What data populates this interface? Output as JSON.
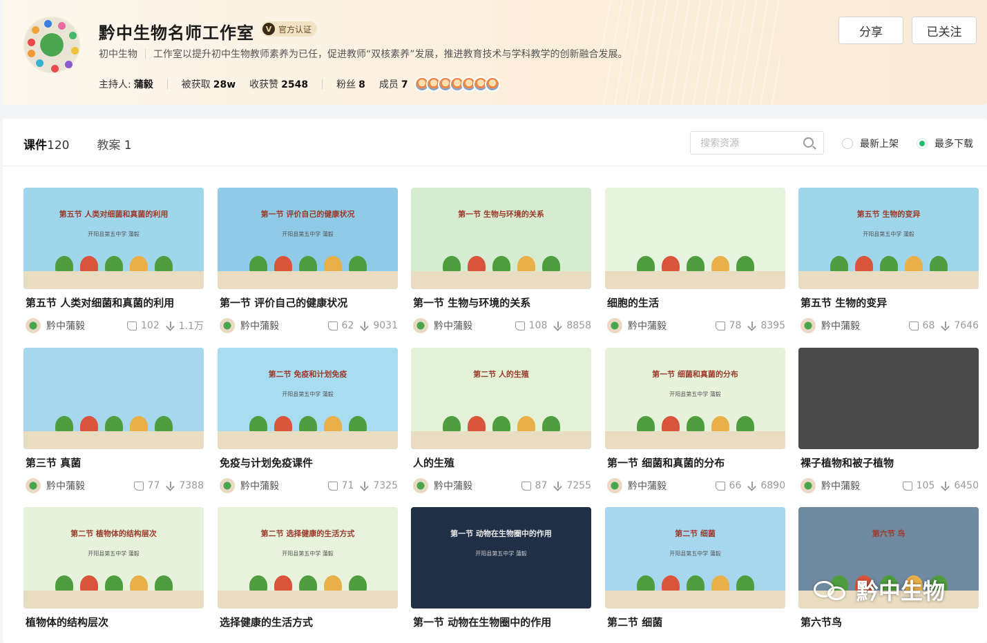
{
  "header": {
    "title": "黔中生物名师工作室",
    "badge_label": "官方认证",
    "badge_icon": "V",
    "subject": "初中生物",
    "description": "工作室以提升初中生物教师素养为已任，促进教师“双核素养”发展，推进教育技术与学科教学的创新融合发展。",
    "host_label": "主持人:",
    "host_name": "蒲毅",
    "stats": [
      {
        "label": "被获取",
        "value": "28w"
      },
      {
        "label": "收获赞",
        "value": "2548"
      },
      {
        "label": "粉丝",
        "value": "8"
      },
      {
        "label": "成员",
        "value": "7"
      }
    ],
    "share_label": "分享",
    "follow_label": "已关注"
  },
  "tabs": [
    {
      "label": "课件",
      "count": "120",
      "active": true
    },
    {
      "label": "教案",
      "count": "1",
      "active": false
    }
  ],
  "search": {
    "placeholder": "搜索资源"
  },
  "sort": {
    "newest": "最新上架",
    "most_downloaded": "最多下载",
    "selected": "most_downloaded"
  },
  "cards": [
    {
      "title": "第五节 人类对细菌和真菌的利用",
      "author": "黔中蒲毅",
      "likes": "102",
      "downloads": "1.1万",
      "thumb_title": "第五节 人类对细菌和真菌的利用",
      "thumb_sub": "开阳县第五中学 蒲毅",
      "bg": "#9fd6ec"
    },
    {
      "title": "第一节 评价自己的健康状况",
      "author": "黔中蒲毅",
      "likes": "62",
      "downloads": "9031",
      "thumb_title": "第一节 评价自己的健康状况",
      "thumb_sub": "开阳县第五中学 蒲毅",
      "bg": "#8fcbe6"
    },
    {
      "title": "第一节 生物与环境的关系",
      "author": "黔中蒲毅",
      "likes": "108",
      "downloads": "8858",
      "thumb_title": "第一节 生物与环境的关系",
      "thumb_sub": "",
      "bg": "#d6ecd0"
    },
    {
      "title": "细胞的生活",
      "author": "黔中蒲毅",
      "likes": "78",
      "downloads": "8395",
      "thumb_title": "",
      "thumb_sub": "",
      "bg": "#e6f3df"
    },
    {
      "title": "第五节 生物的变异",
      "author": "黔中蒲毅",
      "likes": "68",
      "downloads": "7646",
      "thumb_title": "第五节 生物的变异",
      "thumb_sub": "开阳县第五中学 蒲毅",
      "bg": "#9fd6ec"
    },
    {
      "title": "第三节 真菌",
      "author": "黔中蒲毅",
      "likes": "77",
      "downloads": "7388",
      "thumb_title": "",
      "thumb_sub": "",
      "bg": "#a6d7ee"
    },
    {
      "title": "免疫与计划免疫课件",
      "author": "黔中蒲毅",
      "likes": "71",
      "downloads": "7325",
      "thumb_title": "第二节 免疫和计划免疫",
      "thumb_sub": "开阳县第五中学 蒲毅",
      "bg": "#a8dcf0"
    },
    {
      "title": "人的生殖",
      "author": "黔中蒲毅",
      "likes": "87",
      "downloads": "7255",
      "thumb_title": "第二节 人的生殖",
      "thumb_sub": "",
      "bg": "#e3f1d7"
    },
    {
      "title": "第一节 细菌和真菌的分布",
      "author": "黔中蒲毅",
      "likes": "66",
      "downloads": "6890",
      "thumb_title": "第一节 细菌和真菌的分布",
      "thumb_sub": "开阳县第五中学 蒲毅",
      "bg": "#e7f2db"
    },
    {
      "title": "裸子植物和被子植物",
      "author": "黔中蒲毅",
      "likes": "105",
      "downloads": "6450",
      "thumb_title": "",
      "thumb_sub": "",
      "bg": "#4a4a4a"
    },
    {
      "title": "植物体的结构层次",
      "author": "",
      "likes": "",
      "downloads": "",
      "thumb_title": "第二节 植物体的结构层次",
      "thumb_sub": "开阳县第五中学 蒲毅",
      "bg": "#e6f2dc"
    },
    {
      "title": "选择健康的生活方式",
      "author": "",
      "likes": "",
      "downloads": "",
      "thumb_title": "第二节 选择健康的生活方式",
      "thumb_sub": "开阳县第五中学 蒲毅",
      "bg": "#e7f3dd"
    },
    {
      "title": "第一节 动物在生物圈中的作用",
      "author": "",
      "likes": "",
      "downloads": "",
      "thumb_title": "第一节 动物在生物圈中的作用",
      "thumb_sub": "开阳县第五中学 蒲毅",
      "bg": "#1f2f46"
    },
    {
      "title": "第二节 细菌",
      "author": "",
      "likes": "",
      "downloads": "",
      "thumb_title": "第二节 细菌",
      "thumb_sub": "开阳县第五中学 蒲毅",
      "bg": "#a6d7ee"
    },
    {
      "title": "第六节鸟",
      "author": "",
      "likes": "",
      "downloads": "",
      "thumb_title": "第六节 鸟",
      "thumb_sub": "",
      "bg": "#6f8aa0"
    }
  ],
  "watermark": {
    "text": "黔中生物"
  }
}
